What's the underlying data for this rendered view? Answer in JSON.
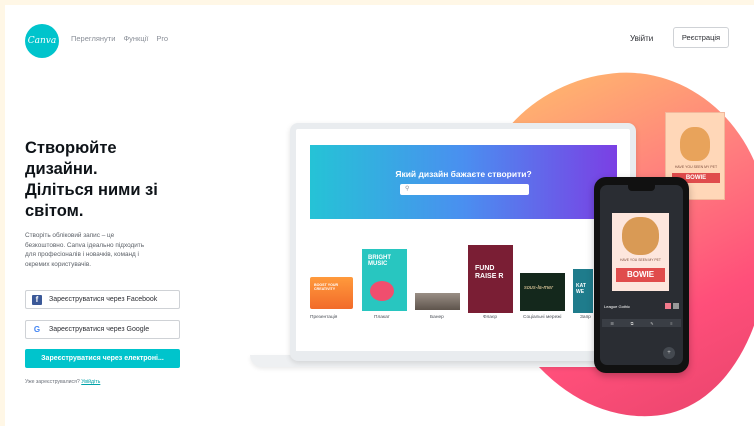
{
  "header": {
    "logo_text": "Canva",
    "nav": [
      "Переглянути",
      "Функції",
      "Pro"
    ],
    "login_label": "Увійти",
    "signup_label": "Реєстрація"
  },
  "hero_text": {
    "headline_lines": [
      "Створюйте",
      "дизайни.",
      "Діліться ними зі",
      "світом."
    ],
    "description_lines": [
      "Створіть обліковий запис – це",
      "безкоштовно. Canva ідеально підходить",
      "для професіоналів і новачків, команд і",
      "окремих користувачів."
    ]
  },
  "signup": {
    "facebook_label": "Зареєструватися через Facebook",
    "google_label": "Зареєструватися через Google",
    "email_label": "Зареєструватися через електроні...",
    "already_text": "Уже зареєструвалися?",
    "login_link": "Увійдіть"
  },
  "illustration": {
    "prompt": "Який дизайн бажаєте створити?",
    "tiles": [
      "Презентація",
      "Плакат",
      "Банер",
      "Флаєр",
      "Соціальні мережі",
      "Запр"
    ],
    "poster_caption": "HAVE YOU SEEN MY PET",
    "poster_name": "BOWIE",
    "phone_caption": "HAVE YOU SEEN MY PET",
    "phone_name": "BOWIE",
    "phone_font": "League Gothic",
    "t2_text": "BRIGHT MUSIC",
    "t4_text": "FUND RAISE R",
    "t5_text": "sous-la-mer",
    "t6_text": "KAT WE",
    "t1_text": "BOOST YOUR CREATIVITY"
  }
}
